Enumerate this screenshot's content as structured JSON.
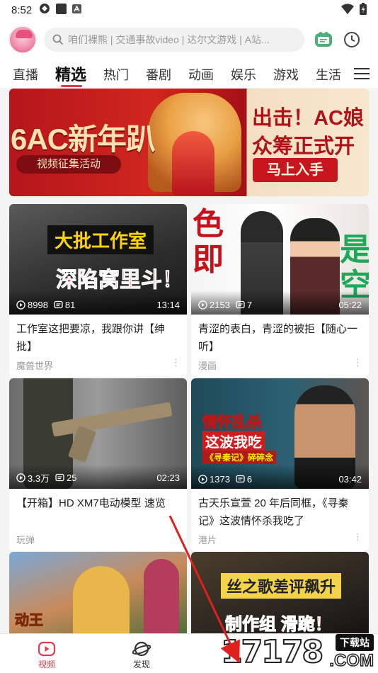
{
  "status_bar": {
    "time": "8:52"
  },
  "header": {
    "search_placeholder": "咱们裸熊 | 交通事故video | 达尔文游戏 | A站..."
  },
  "tabs": [
    {
      "label": "直播"
    },
    {
      "label": "精选",
      "active": true
    },
    {
      "label": "热门"
    },
    {
      "label": "番剧"
    },
    {
      "label": "动画"
    },
    {
      "label": "娱乐"
    },
    {
      "label": "游戏"
    },
    {
      "label": "生活"
    }
  ],
  "banner": {
    "title": "6AC新年趴",
    "subtitle": "视频征集活动",
    "right_line1": "出击！AC娘",
    "right_line2": "众筹正式开",
    "button": "马上入手"
  },
  "videos": [
    {
      "thumb_text1": "大批工作室",
      "thumb_text2": "深陷窝里斗！",
      "plays": "8998",
      "comments": "81",
      "duration": "13:14",
      "title": "工作室这把要凉，我跟你讲【绅批】",
      "channel": "魔兽世界"
    },
    {
      "thumb_text1": "色即",
      "thumb_text2": "是空",
      "plays": "2153",
      "comments": "7",
      "duration": "05:22",
      "title": "青涩的表白，青涩的被拒【随心一听】",
      "channel": "漫画"
    },
    {
      "plays": "3.3万",
      "comments": "25",
      "duration": "02:23",
      "title": "【开箱】HD XM7电动模型 速览",
      "channel": "玩弹"
    },
    {
      "thumb_text1": "情怀乱杀",
      "thumb_text2": "这波我吃",
      "thumb_text3": "《寻秦记》碎碎念",
      "plays": "1373",
      "comments": "6",
      "duration": "03:42",
      "title": "古天乐宣萱 20 年后同框，《寻秦记》这波情怀杀我吃了",
      "channel": "港片"
    },
    {
      "thumb_text1": "动王"
    },
    {
      "thumb_text1": "丝之歌差评飙升",
      "thumb_text2": "制作组 滑跪！"
    }
  ],
  "bottom_nav": [
    {
      "label": "视频",
      "active": true
    },
    {
      "label": "发现"
    }
  ],
  "watermark": {
    "digits": "17178",
    "badge": "下载站",
    "suffix": ".COM"
  },
  "colors": {
    "accent": "#e4394f",
    "banner_red": "#c8161f"
  }
}
